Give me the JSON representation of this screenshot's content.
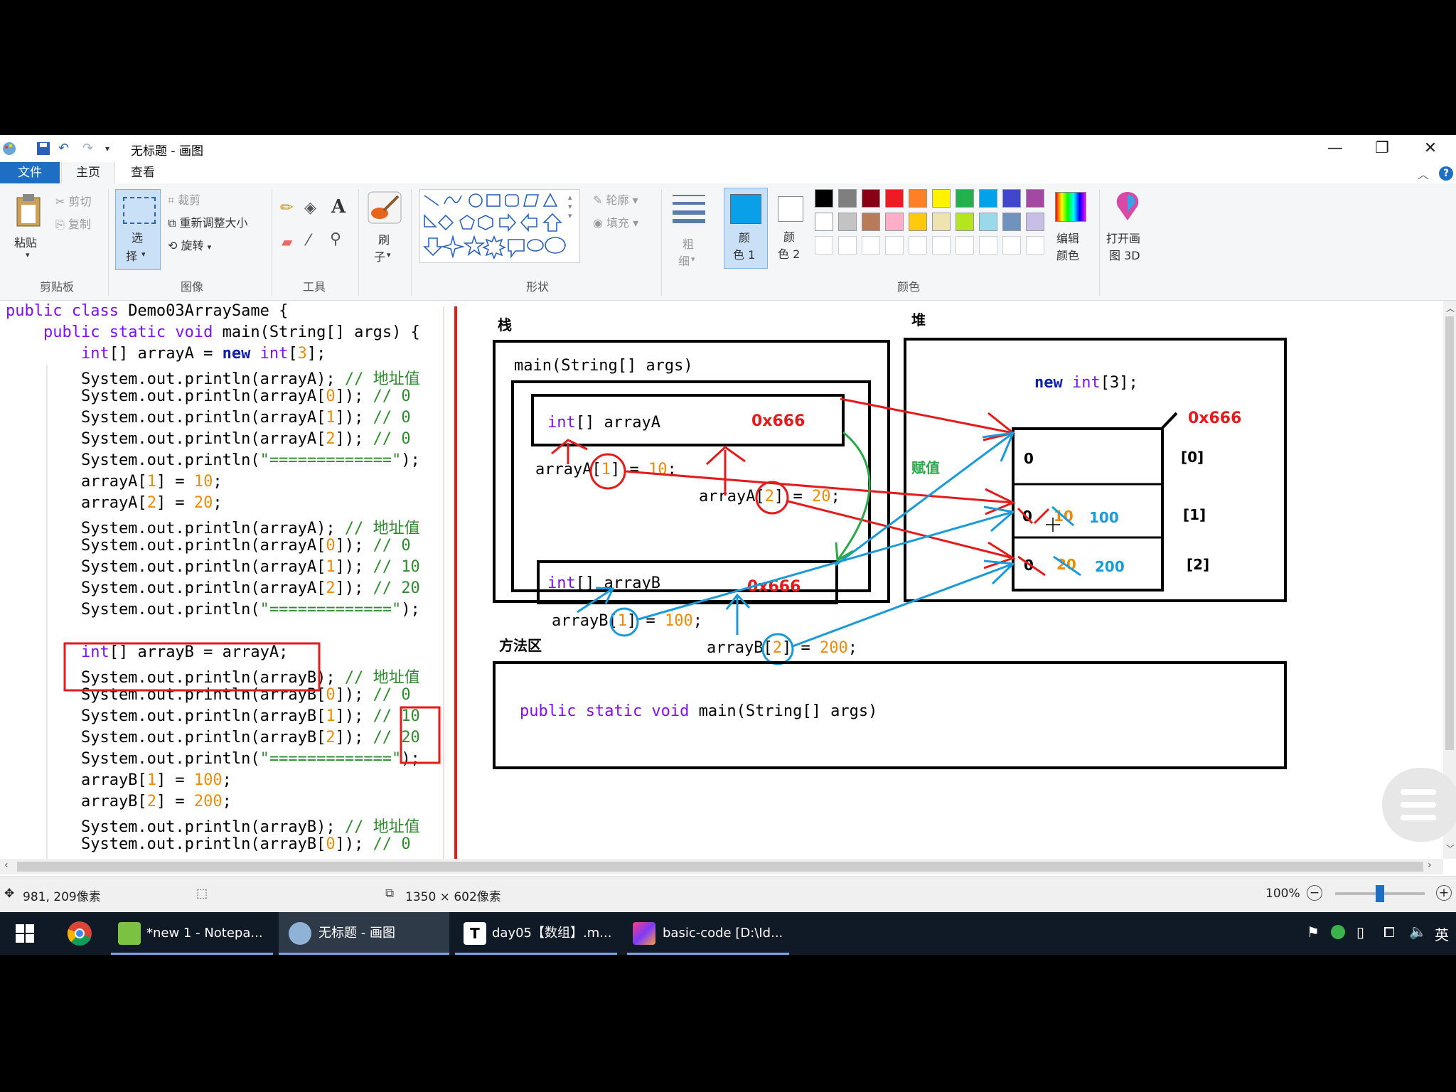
{
  "window": {
    "title": "无标题 - 画图",
    "minimize_glyph": "—",
    "restore_glyph": "❐",
    "close_glyph": "✕",
    "help_glyph": "?"
  },
  "tabs": [
    "文件",
    "主页",
    "查看"
  ],
  "ribbon": {
    "clipboard": {
      "paste": "粘贴",
      "cut": "剪切",
      "copy": "复制",
      "group": "剪贴板"
    },
    "image": {
      "select_1": "选",
      "select_2": "择",
      "crop": "裁剪",
      "resize": "重新调整大小",
      "rotate": "旋转",
      "group": "图像"
    },
    "tools": {
      "group": "工具"
    },
    "brush": {
      "l1": "刷",
      "l2": "子"
    },
    "shapes": {
      "outline": "轮廓",
      "fill": "填充",
      "group": "形状"
    },
    "size": {
      "l1": "粗",
      "l2": "细"
    },
    "color1": {
      "l1": "颜",
      "l2": "色 1"
    },
    "color2": {
      "l1": "颜",
      "l2": "色 2"
    },
    "edit_colors": {
      "l1": "编辑",
      "l2": "颜色"
    },
    "paint3d": {
      "l1": "打开画",
      "l2": "图 3D"
    },
    "colors_group": "颜色",
    "palette_row1": [
      "#000000",
      "#7f7f7f",
      "#880015",
      "#ed1c24",
      "#ff7f27",
      "#fff200",
      "#22b14c",
      "#00a2e8",
      "#3f48cc",
      "#a349a4"
    ],
    "palette_row2": [
      "#ffffff",
      "#c3c3c3",
      "#b97a57",
      "#ffaec9",
      "#ffc90e",
      "#efe4b0",
      "#b5e61d",
      "#99d9ea",
      "#7092be",
      "#c8bfe7"
    ],
    "color1_value": "#0aa0e8"
  },
  "code_lines": [
    [
      [
        "kw",
        "public class "
      ],
      [
        "",
        "Demo03ArraySame {"
      ]
    ],
    [
      [
        "",
        "    "
      ],
      [
        "kw",
        "public static void "
      ],
      [
        "",
        "main(String[] args) {"
      ]
    ],
    [
      [
        "",
        "        "
      ],
      [
        "kw",
        "int"
      ],
      [
        "",
        "[] arrayA = "
      ],
      [
        "kw2",
        "new "
      ],
      [
        "kw",
        "int"
      ],
      [
        "",
        "["
      ],
      [
        "num",
        "3"
      ],
      [
        "",
        "];"
      ]
    ],
    [
      [
        "",
        "        System.out.println(arrayA); "
      ],
      [
        "cm",
        "// 地址值"
      ]
    ],
    [
      [
        "",
        "        System.out.println(arrayA["
      ],
      [
        "num",
        "0"
      ],
      [
        "",
        "]); "
      ],
      [
        "cm",
        "// 0"
      ]
    ],
    [
      [
        "",
        "        System.out.println(arrayA["
      ],
      [
        "num",
        "1"
      ],
      [
        "",
        "]); "
      ],
      [
        "cm",
        "// 0"
      ]
    ],
    [
      [
        "",
        "        System.out.println(arrayA["
      ],
      [
        "num",
        "2"
      ],
      [
        "",
        "]); "
      ],
      [
        "cm",
        "// 0"
      ]
    ],
    [
      [
        "",
        "        System.out.println("
      ],
      [
        "cm",
        "\"=============\""
      ],
      [
        "",
        "); "
      ]
    ],
    [
      [
        "",
        "        arrayA["
      ],
      [
        "num",
        "1"
      ],
      [
        "",
        "] = "
      ],
      [
        "num",
        "10"
      ],
      [
        "",
        ";"
      ]
    ],
    [
      [
        "",
        "        arrayA["
      ],
      [
        "num",
        "2"
      ],
      [
        "",
        "] = "
      ],
      [
        "num",
        "20"
      ],
      [
        "",
        ";"
      ]
    ],
    [
      [
        "",
        "        System.out.println(arrayA); "
      ],
      [
        "cm",
        "// 地址值"
      ]
    ],
    [
      [
        "",
        "        System.out.println(arrayA["
      ],
      [
        "num",
        "0"
      ],
      [
        "",
        "]); "
      ],
      [
        "cm",
        "// 0"
      ]
    ],
    [
      [
        "",
        "        System.out.println(arrayA["
      ],
      [
        "num",
        "1"
      ],
      [
        "",
        "]); "
      ],
      [
        "cm",
        "// 10"
      ]
    ],
    [
      [
        "",
        "        System.out.println(arrayA["
      ],
      [
        "num",
        "2"
      ],
      [
        "",
        "]); "
      ],
      [
        "cm",
        "// 20"
      ]
    ],
    [
      [
        "",
        "        System.out.println("
      ],
      [
        "cm",
        "\"=============\""
      ],
      [
        "",
        "); "
      ]
    ],
    [
      [
        "",
        ""
      ]
    ],
    [
      [
        "",
        "        "
      ],
      [
        "kw",
        "int"
      ],
      [
        "",
        "[] arrayB = arrayA;"
      ]
    ],
    [
      [
        "",
        "        System.out.println(arrayB); "
      ],
      [
        "cm",
        "// 地址值"
      ]
    ],
    [
      [
        "",
        "        System.out.println(arrayB["
      ],
      [
        "num",
        "0"
      ],
      [
        "",
        "]); "
      ],
      [
        "cm",
        "// 0"
      ]
    ],
    [
      [
        "",
        "        System.out.println(arrayB["
      ],
      [
        "num",
        "1"
      ],
      [
        "",
        "]); "
      ],
      [
        "cm",
        "// 10"
      ]
    ],
    [
      [
        "",
        "        System.out.println(arrayB["
      ],
      [
        "num",
        "2"
      ],
      [
        "",
        "]); "
      ],
      [
        "cm",
        "// 20"
      ]
    ],
    [
      [
        "",
        "        System.out.println("
      ],
      [
        "cm",
        "\"=============\""
      ],
      [
        "",
        "); "
      ]
    ],
    [
      [
        "",
        "        arrayB["
      ],
      [
        "num",
        "1"
      ],
      [
        "",
        "] = "
      ],
      [
        "num",
        "100"
      ],
      [
        "",
        ";"
      ]
    ],
    [
      [
        "",
        "        arrayB["
      ],
      [
        "num",
        "2"
      ],
      [
        "",
        "] = "
      ],
      [
        "num",
        "200"
      ],
      [
        "",
        ";"
      ]
    ],
    [
      [
        "",
        "        System.out.println(arrayB); "
      ],
      [
        "cm",
        "// 地址值"
      ]
    ],
    [
      [
        "",
        "        System.out.println(arrayB["
      ],
      [
        "num",
        "0"
      ],
      [
        "",
        "]); "
      ],
      [
        "cm",
        "// 0"
      ]
    ]
  ],
  "diagram": {
    "stack_label": "栈",
    "heap_label": "堆",
    "method_area_label": "方法区",
    "main_frame": "main(String[] args)",
    "arrayA_decl_kw": "int",
    "arrayA_decl": "[] arrayA",
    "arrayA_addr": "0x666",
    "assign_a1_pre": "arrayA[",
    "assign_a1_idx": "1",
    "assign_a1_post": "] = ",
    "assign_a1_val": "10",
    "assign_a2_pre": "arrayA[",
    "assign_a2_idx": "2",
    "assign_a2_post": "] = ",
    "assign_a2_val": "20",
    "arrayB_decl_kw": "int",
    "arrayB_decl": "[] arrayB",
    "arrayB_addr": "0x666",
    "assign_b1_pre": "arrayB[",
    "assign_b1_idx": "1",
    "assign_b1_post": "] = ",
    "assign_b1_val": "100",
    "assign_b2_pre": "arrayB[",
    "assign_b2_idx": "2",
    "assign_b2_post": "] = ",
    "assign_b2_val": "200",
    "assign_label": "赋值",
    "heap_new_kw": "new ",
    "heap_new_type": "int",
    "heap_new_rest": "[3];",
    "heap_addr": "0x666",
    "cells": [
      {
        "index": "[0]",
        "old": "0",
        "old2": "",
        "new": ""
      },
      {
        "index": "[1]",
        "old": "0",
        "old2": "10",
        "new": "100"
      },
      {
        "index": "[2]",
        "old": "0",
        "old2": "20",
        "new": "200"
      }
    ],
    "method_kw": "public static void ",
    "method_rest": "main(String[] args)"
  },
  "status": {
    "cursor": "981, 209像素",
    "size": "1350 × 602像素",
    "zoom": "100%",
    "zoom_level": 0.5
  },
  "taskbar": {
    "items": [
      "*new 1 - Notepa...",
      "无标题 - 画图",
      "day05【数组】.m...",
      "basic-code [D:\\Id..."
    ],
    "lang": "英"
  }
}
